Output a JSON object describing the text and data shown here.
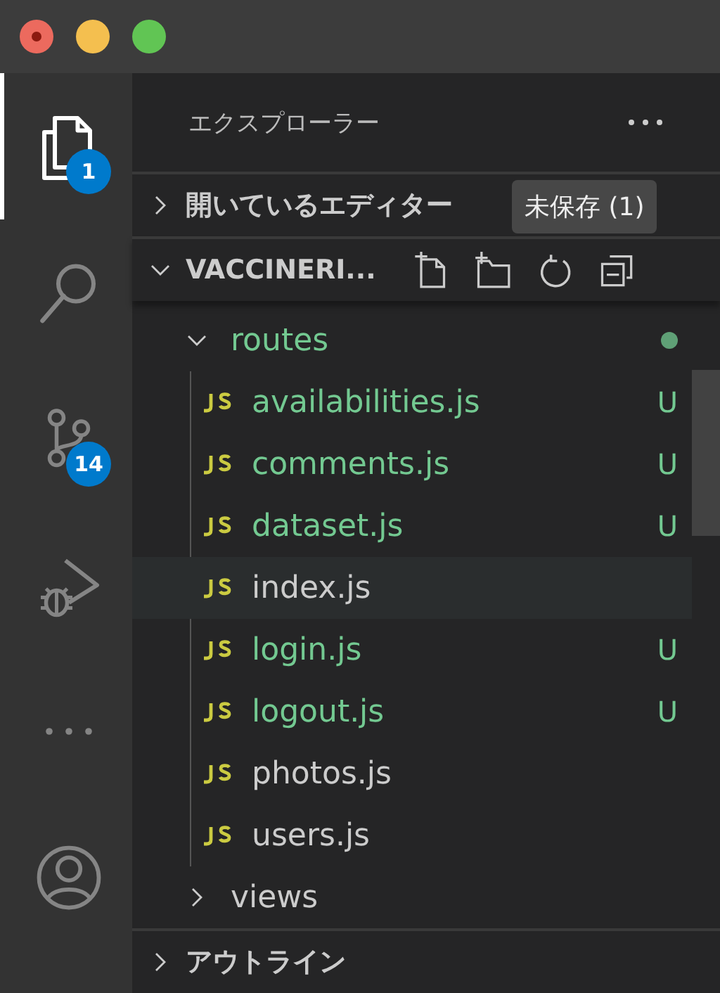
{
  "activity_bar": [
    {
      "kind": "files",
      "selected": true,
      "badge": "1"
    },
    {
      "kind": "search",
      "selected": false
    },
    {
      "kind": "source-control",
      "selected": false,
      "badge": "14"
    },
    {
      "kind": "run",
      "selected": false
    },
    {
      "kind": "more",
      "selected": false
    },
    {
      "kind": "account",
      "selected": false
    }
  ],
  "sidebar": {
    "title": "エクスプローラー",
    "sections": [
      {
        "title": "開いているエディター",
        "expanded": false,
        "tooltip": "未保存 (1)"
      },
      {
        "title": "VACCINERI...",
        "expanded": true,
        "tree": [
          {
            "name": "routes",
            "expanded": true,
            "modified": true,
            "children": [
              {
                "name": "availabilities.js",
                "status": "U",
                "selected": false
              },
              {
                "name": "comments.js",
                "status": "U",
                "selected": false
              },
              {
                "name": "dataset.js",
                "status": "U",
                "selected": false
              },
              {
                "name": "index.js",
                "selected": true
              },
              {
                "name": "login.js",
                "status": "U",
                "selected": false
              },
              {
                "name": "logout.js",
                "status": "U",
                "selected": false
              },
              {
                "name": "photos.js",
                "selected": false
              },
              {
                "name": "users.js",
                "selected": false
              }
            ]
          },
          {
            "name": "views",
            "expanded": false,
            "modified": false
          }
        ]
      },
      {
        "title": "アウトライン",
        "expanded": false
      }
    ]
  }
}
